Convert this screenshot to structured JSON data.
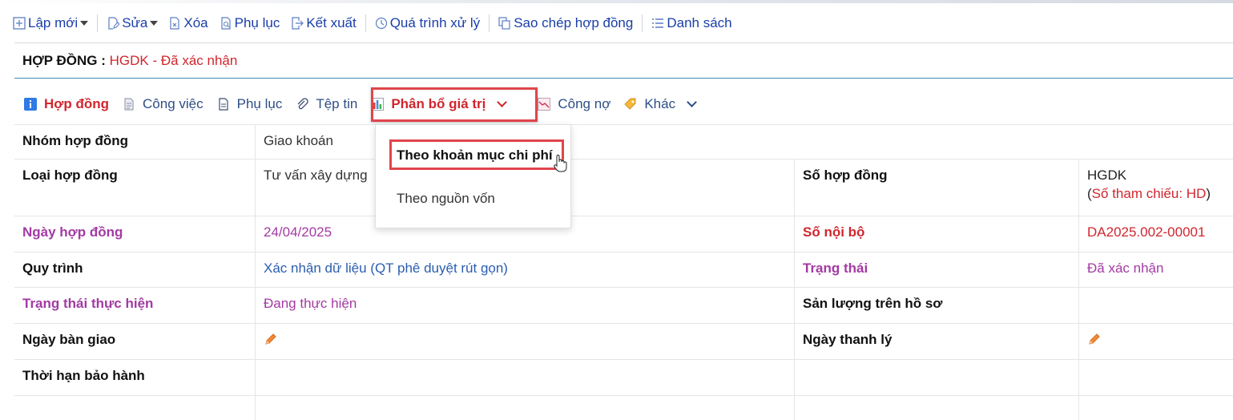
{
  "toolbar": {
    "new_label": "Lập mới",
    "edit_label": "Sửa",
    "delete_label": "Xóa",
    "appendix_label": "Phụ lục",
    "export_label": "Kết xuất",
    "process_label": "Quá trình xử lý",
    "copy_label": "Sao chép hợp đồng",
    "list_label": "Danh sách"
  },
  "header": {
    "title": "HỢP ĐỒNG : ",
    "status": "HGDK - Đã xác nhận"
  },
  "tabs": [
    {
      "label": "Hợp đồng",
      "icon": "info-icon"
    },
    {
      "label": "Công việc",
      "icon": "document-icon"
    },
    {
      "label": "Phụ lục",
      "icon": "file-icon"
    },
    {
      "label": "Tệp tin",
      "icon": "paperclip-icon"
    },
    {
      "label": "Phân bổ giá trị",
      "icon": "bar-chart-icon"
    },
    {
      "label": "Công nợ",
      "icon": "trend-chart-icon"
    },
    {
      "label": "Khác",
      "icon": "tag-icon"
    }
  ],
  "dropdown": {
    "items": [
      "Theo khoản mục chi phí",
      "Theo nguồn vốn"
    ]
  },
  "fields": {
    "group_label": "Nhóm hợp đồng",
    "group_value": "Giao khoán",
    "type_label": "Loại hợp đồng",
    "type_value": "Tư vấn xây dựng",
    "number_label": "Số hợp đồng",
    "number_value": "HGDK",
    "number_ref_open": "(",
    "number_ref": "Số tham chiếu: HD",
    "number_ref_close": ")",
    "date_label": "Ngày hợp đồng",
    "date_value": "24/04/2025",
    "internal_label": "Số nội bộ",
    "internal_value": "DA2025.002-00001",
    "process_label": "Quy trình",
    "process_value": "Xác nhận dữ liệu (QT phê duyệt rút gọn)",
    "status_label": "Trạng thái",
    "status_value": "Đã xác nhận",
    "exec_status_label": "Trạng thái thực hiện",
    "exec_status_value": "Đang thực hiện",
    "output_label": "Sản lượng trên hồ sơ",
    "output_value": "",
    "handover_label": "Ngày bàn giao",
    "liquidation_label": "Ngày thanh lý",
    "warranty_label": "Thời hạn bảo hành"
  },
  "colors": {
    "accent_red": "#d0262e",
    "link_blue": "#1a3ea8",
    "purple": "#a33aa3",
    "highlight_box": "#e0464c"
  }
}
